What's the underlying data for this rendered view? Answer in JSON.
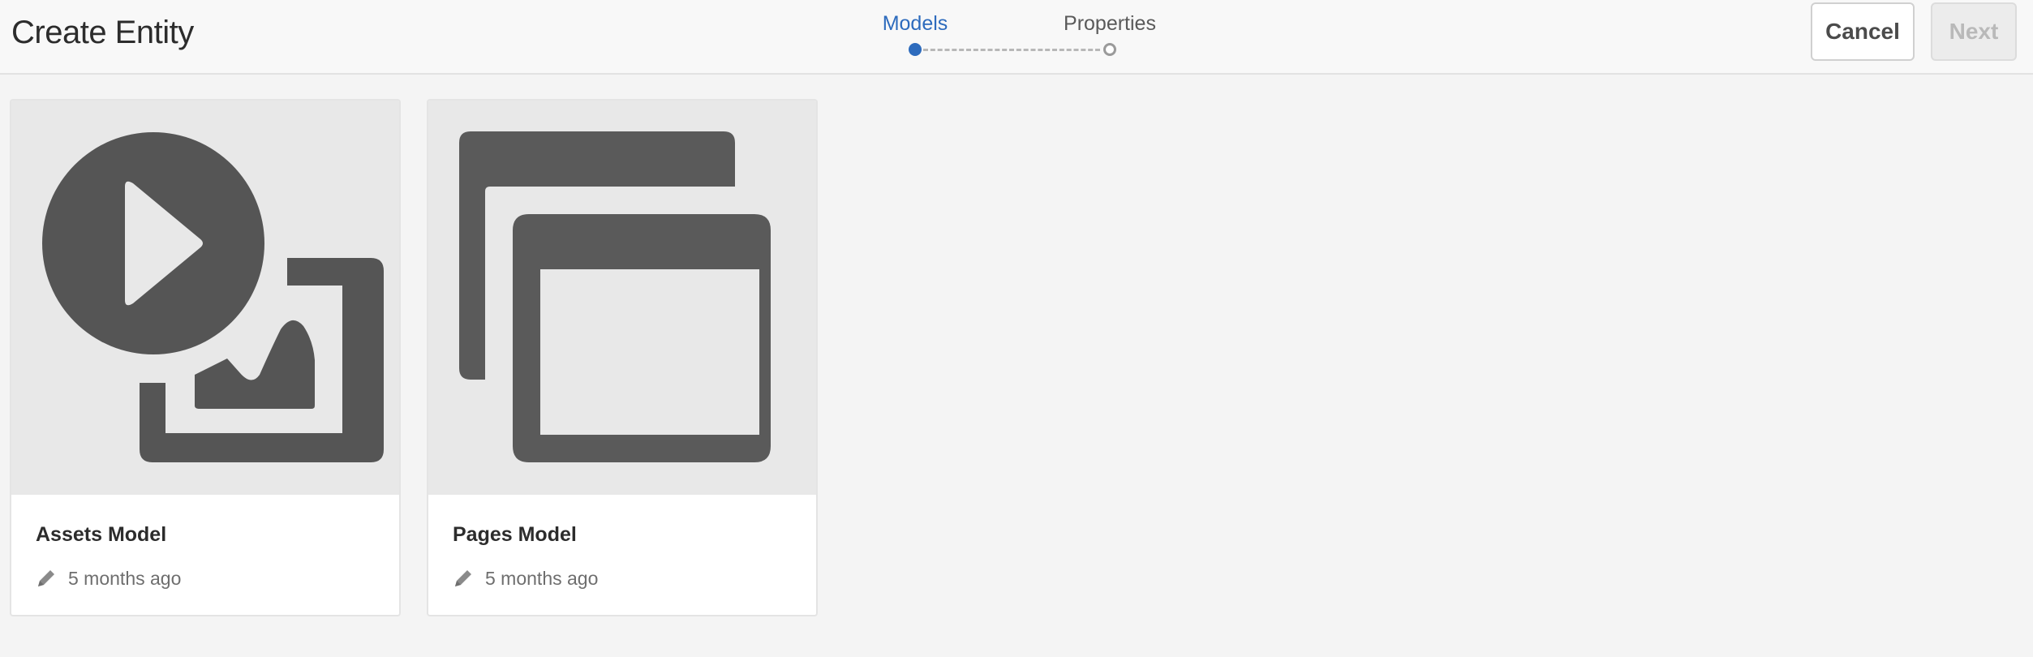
{
  "header": {
    "title": "Create Entity",
    "steps": [
      {
        "label": "Models",
        "active": true
      },
      {
        "label": "Properties",
        "active": false
      }
    ],
    "cancel_label": "Cancel",
    "next_label": "Next"
  },
  "cards": [
    {
      "title": "Assets Model",
      "modified": "5 months ago",
      "icon": "asset-video-image-icon",
      "edit_icon": "pencil-icon"
    },
    {
      "title": "Pages Model",
      "modified": "5 months ago",
      "icon": "pages-windows-icon",
      "edit_icon": "pencil-icon"
    }
  ],
  "colors": {
    "accent": "#2d6bbd",
    "icon_fill": "#555555",
    "thumb_bg": "#e8e8e8"
  }
}
